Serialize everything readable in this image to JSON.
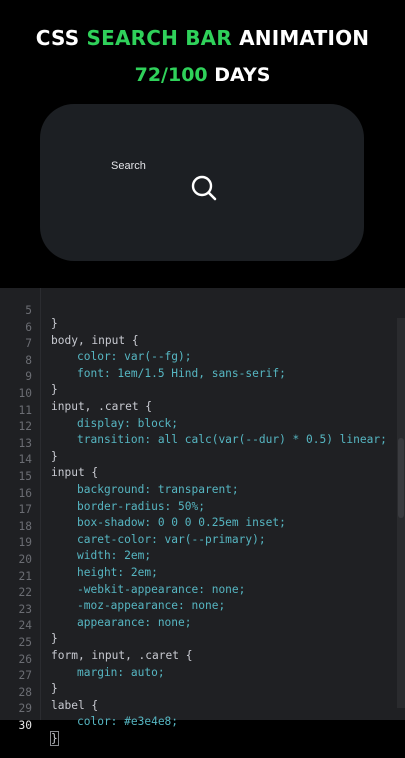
{
  "header": {
    "title_css": "CSS",
    "title_search_bar": "SEARCH BAR",
    "title_animation": "ANIMATION",
    "progress": "72/100",
    "days": "DAYS",
    "accent_color": "#2fd15a"
  },
  "demo": {
    "search_label": "Search",
    "icon": "search-icon"
  },
  "editor": {
    "active_line": "30",
    "lines": [
      {
        "n": "5",
        "t": "}"
      },
      {
        "n": "6",
        "t": "body, input {"
      },
      {
        "n": "7",
        "t": "color: var(--fg);"
      },
      {
        "n": "8",
        "t": "font: 1em/1.5 Hind, sans-serif;"
      },
      {
        "n": "9",
        "t": "}"
      },
      {
        "n": "10",
        "t": "input, .caret {"
      },
      {
        "n": "11",
        "t": "display: block;"
      },
      {
        "n": "12",
        "t": "transition: all calc(var(--dur) * 0.5) linear;"
      },
      {
        "n": "13",
        "t": "}"
      },
      {
        "n": "14",
        "t": "input {"
      },
      {
        "n": "15",
        "t": "background: transparent;"
      },
      {
        "n": "16",
        "t": "border-radius: 50%;"
      },
      {
        "n": "17",
        "t": "box-shadow: 0 0 0 0.25em inset;"
      },
      {
        "n": "18",
        "t": "caret-color: var(--primary);"
      },
      {
        "n": "19",
        "t": "width: 2em;"
      },
      {
        "n": "20",
        "t": "height: 2em;"
      },
      {
        "n": "21",
        "t": "-webkit-appearance: none;"
      },
      {
        "n": "22",
        "t": "-moz-appearance: none;"
      },
      {
        "n": "23",
        "t": "appearance: none;"
      },
      {
        "n": "24",
        "t": "}"
      },
      {
        "n": "25",
        "t": "form, input, .caret {"
      },
      {
        "n": "26",
        "t": "margin: auto;"
      },
      {
        "n": "27",
        "t": "}"
      },
      {
        "n": "28",
        "t": "label {"
      },
      {
        "n": "29",
        "t": "color: #e3e4e8;"
      },
      {
        "n": "30",
        "t": "}"
      }
    ]
  }
}
